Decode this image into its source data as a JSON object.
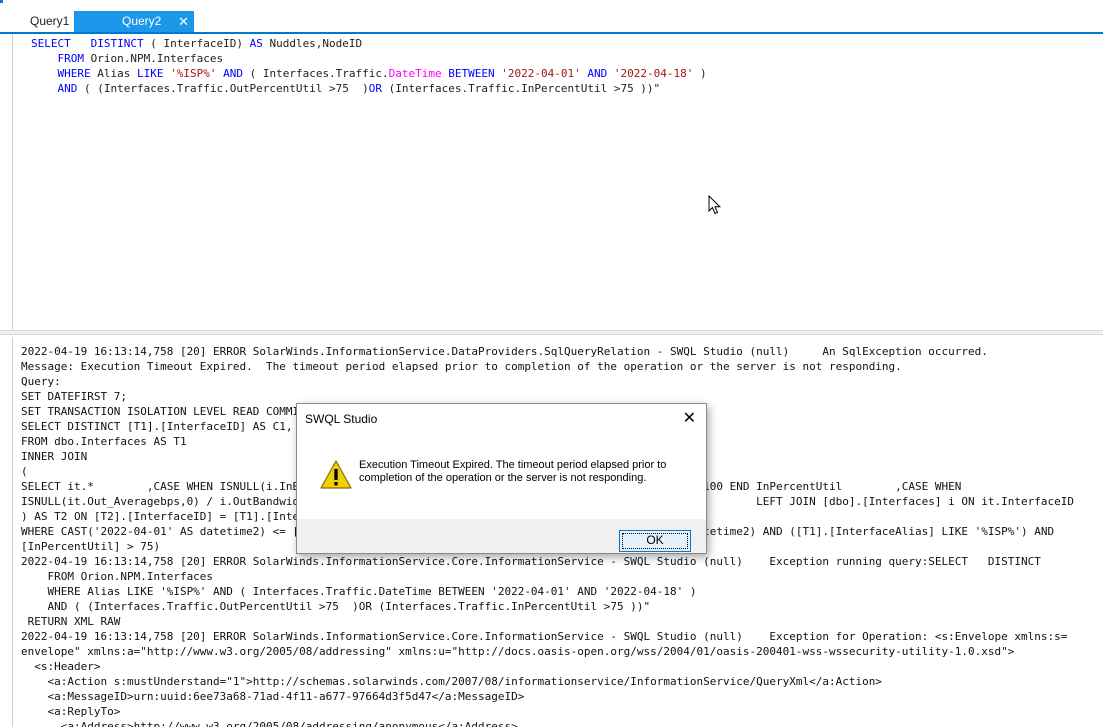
{
  "tabs": [
    {
      "label": "Query1",
      "active": false
    },
    {
      "label": "Query2",
      "active": true,
      "close_glyph": "✕"
    }
  ],
  "editor": {
    "lines": [
      {
        "parts": [
          [
            "kw",
            "SELECT"
          ],
          [
            "",
            "   "
          ],
          [
            "kw",
            "DISTINCT"
          ],
          [
            "",
            " ( InterfaceID) "
          ],
          [
            "kw",
            "AS"
          ],
          [
            "",
            " Nuddles,NodeID"
          ]
        ]
      },
      {
        "parts": [
          [
            "",
            "    "
          ],
          [
            "kw",
            "FROM"
          ],
          [
            "",
            " Orion.NPM.Interfaces"
          ]
        ]
      },
      {
        "parts": [
          [
            "",
            "    "
          ],
          [
            "kw",
            "WHERE"
          ],
          [
            "",
            " Alias "
          ],
          [
            "kw",
            "LIKE"
          ],
          [
            "",
            " "
          ],
          [
            "str",
            "'%ISP%'"
          ],
          [
            "",
            " "
          ],
          [
            "kw",
            "AND"
          ],
          [
            "",
            " ( Interfaces.Traffic."
          ],
          [
            "fn",
            "DateTime"
          ],
          [
            "",
            " "
          ],
          [
            "kw",
            "BETWEEN"
          ],
          [
            "",
            " "
          ],
          [
            "str",
            "'2022-04-01'"
          ],
          [
            "",
            " "
          ],
          [
            "kw",
            "AND"
          ],
          [
            "",
            " "
          ],
          [
            "str",
            "'2022-04-18'"
          ],
          [
            "",
            " )"
          ]
        ]
      },
      {
        "parts": [
          [
            "",
            "    "
          ],
          [
            "kw",
            "AND"
          ],
          [
            "",
            " ( (Interfaces.Traffic.OutPercentUtil >75  )"
          ],
          [
            "kw",
            "OR"
          ],
          [
            "",
            " (Interfaces.Traffic.InPercentUtil >75 ))\""
          ]
        ]
      }
    ]
  },
  "log_lines": [
    "2022-04-19 16:13:14,758 [20] ERROR SolarWinds.InformationService.DataProviders.SqlQueryRelation - SWQL Studio (null)     An SqlException occurred.",
    "Message: Execution Timeout Expired.  The timeout period elapsed prior to completion of the operation or the server is not responding.",
    "Query:",
    "SET DATEFIRST 7;",
    "SET TRANSACTION ISOLATION LEVEL READ COMMITTED;",
    "SELECT DISTINCT [T1].[InterfaceID] AS C1, [T1].[NodeID] AS C2",
    "FROM dbo.Interfaces AS T1",
    "INNER JOIN",
    "(",
    "SELECT it.*        ,CASE WHEN ISNULL(i.InBandwidth,0)=0 THEN 0 ELSE it.In_Averagebps / i.InBandwidth * 100 END InPercentUtil        ,CASE WHEN",
    "ISNULL(it.Out_Averagebps,0) / i.OutBandwidth * 100 END OutPercentUtil  FROM [dbo].[InterfaceTraffic] it        LEFT JOIN [dbo].[Interfaces] i ON it.InterfaceID",
    ") AS T2 ON [T2].[InterfaceID] = [T1].[InterfaceID]",
    "WHERE CAST('2022-04-01' AS datetime2) <= [T2].[DateTime] AND [T2].[DateTime] <= CAST('2022-04-18' AS datetime2) AND ([T1].[InterfaceAlias] LIKE '%ISP%') AND",
    "[InPercentUtil] > 75)",
    "2022-04-19 16:13:14,758 [20] ERROR SolarWinds.InformationService.Core.InformationService - SWQL Studio (null)    Exception running query:SELECT   DISTINCT",
    "    FROM Orion.NPM.Interfaces",
    "    WHERE Alias LIKE '%ISP%' AND ( Interfaces.Traffic.DateTime BETWEEN '2022-04-01' AND '2022-04-18' )",
    "    AND ( (Interfaces.Traffic.OutPercentUtil >75  )OR (Interfaces.Traffic.InPercentUtil >75 ))\"",
    " RETURN XML RAW",
    "2022-04-19 16:13:14,758 [20] ERROR SolarWinds.InformationService.Core.InformationService - SWQL Studio (null)    Exception for Operation: <s:Envelope xmlns:s=",
    "envelope\" xmlns:a=\"http://www.w3.org/2005/08/addressing\" xmlns:u=\"http://docs.oasis-open.org/wss/2004/01/oasis-200401-wss-wssecurity-utility-1.0.xsd\">",
    "  <s:Header>",
    "    <a:Action s:mustUnderstand=\"1\">http://schemas.solarwinds.com/2007/08/informationservice/InformationService/QueryXml</a:Action>",
    "    <a:MessageID>urn:uuid:6ee73a68-71ad-4f11-a677-97664d3f5d47</a:MessageID>",
    "    <a:ReplyTo>",
    "      <a:Address>http://www.w3.org/2005/08/addressing/anonymous</a:Address>"
  ],
  "dialog": {
    "title": "SWQL Studio",
    "close_glyph": "✕",
    "icon": "warning-icon",
    "message": "Execution Timeout Expired.  The timeout period elapsed prior to completion of the operation or the server is not responding.",
    "ok_label": "OK"
  },
  "colors": {
    "accent": "#007acc",
    "active_tab": "#1c97ea",
    "keyword": "#0000ff",
    "string": "#a31515",
    "function": "#ff00ff",
    "warning": "#f5d000"
  }
}
